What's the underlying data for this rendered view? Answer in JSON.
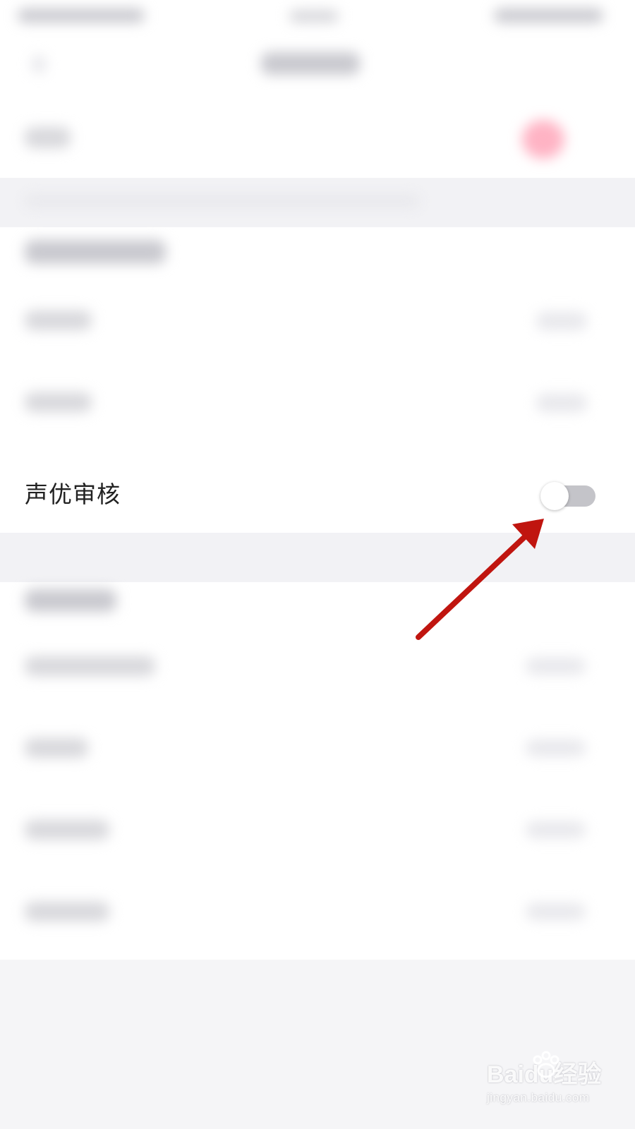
{
  "setting": {
    "label": "声优审核",
    "enabled": false
  },
  "watermark": {
    "brand": "Baidu经验",
    "url": "jingyan.baidu.com"
  },
  "colors": {
    "toggle_off_track": "#c4c4c9",
    "annotation_arrow": "#c0150f",
    "background": "#f5f5f7"
  },
  "icons": {
    "toggle": "switch-off-icon",
    "annotation": "red-arrow-icon",
    "watermark": "paw-icon"
  }
}
